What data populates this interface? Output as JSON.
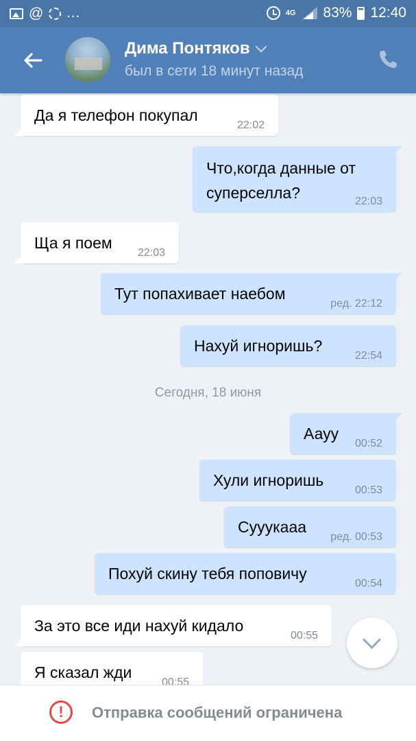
{
  "status_bar": {
    "battery": "83%",
    "time": "12:40",
    "network": "4G",
    "dots": "..."
  },
  "header": {
    "name": "Дима Понтяков",
    "status": "был в сети 18 минут назад"
  },
  "messages": [
    {
      "dir": "in",
      "text": "Да я телефон покупал",
      "time": "22:02"
    },
    {
      "dir": "out",
      "text_line1": "Что,когда данные от",
      "text_line2": "суперселла?",
      "time": "22:03"
    },
    {
      "dir": "in",
      "text": "Ща я поем",
      "time": "22:03"
    },
    {
      "dir": "out",
      "text": "Тут попахивает наебом",
      "time": "ред. 22:12"
    },
    {
      "dir": "out",
      "text": "Нахуй игноришь?",
      "time": "22:54"
    },
    {
      "dir": "out",
      "text": "Аауу",
      "time": "00:52"
    },
    {
      "dir": "out",
      "text": "Хули игноришь",
      "time": "00:53"
    },
    {
      "dir": "out",
      "text": "Сууукааа",
      "time": "ред. 00:53"
    },
    {
      "dir": "out",
      "text": "Похуй скину тебя поповичу",
      "time": "00:54"
    },
    {
      "dir": "in",
      "text": "За это все иди нахуй кидало",
      "time": "00:55"
    },
    {
      "dir": "in",
      "text": "Я сказал жди",
      "time": "00:55"
    }
  ],
  "day_separator": "Сегодня, 18 июня",
  "footer": {
    "icon_text": "!",
    "text": "Отправка сообщений ограничена"
  },
  "colors": {
    "header": "#5181b8",
    "status_bar": "#4a76a8",
    "incoming_bubble": "#ffffff",
    "outgoing_bubble": "#cce4ff",
    "chat_background": "#eef2f6",
    "warning": "#e64646"
  }
}
